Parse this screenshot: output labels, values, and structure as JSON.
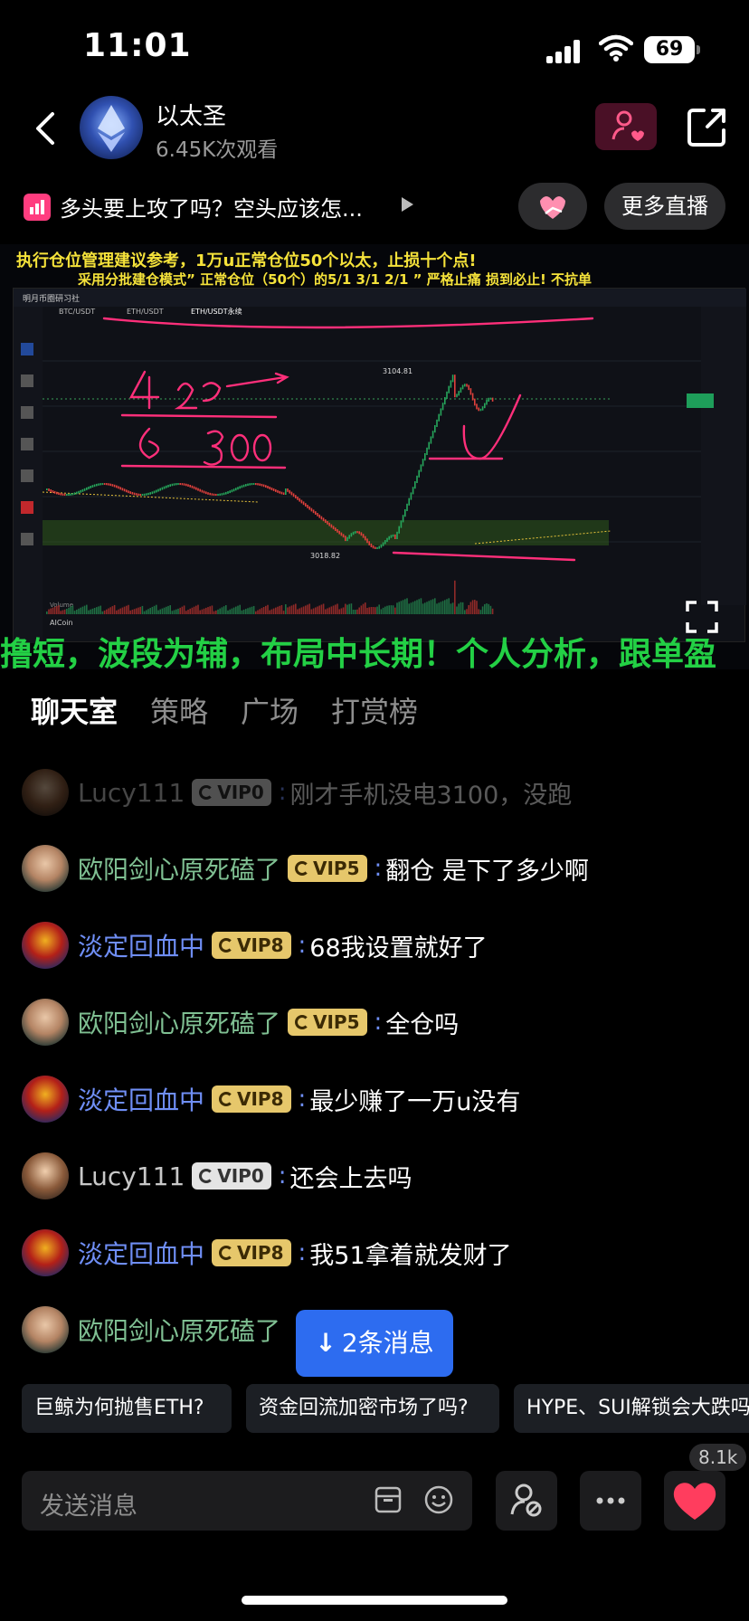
{
  "status_bar": {
    "time": "11:01",
    "battery": "69"
  },
  "header": {
    "title": "以太圣",
    "views": "6.45K次观看",
    "more_live": "更多直播"
  },
  "topic": {
    "text": "多头要上攻了吗？空头应该怎..."
  },
  "video": {
    "banner_line1": "执行仓位管理建议参考，1万u正常仓位50个以太，止损十个点!",
    "banner_line2": "采用分批建仓模式” 正常仓位（50个）的5/1  3/1  2/1 ” 严格止痛 损到必止! 不抗单",
    "scroll_text": "撸短，波段为辅，布局中长期！个人分析，跟单盈",
    "chart_labels": {
      "pair1": "BTC/USDT",
      "pair2": "ETH/USDT",
      "pair3": "ETH/USDT永续",
      "brand": "明月币圈研习社",
      "high": "3104.81",
      "low": "3018.82",
      "source": "AICoin",
      "volume": "Volume"
    }
  },
  "tabs": [
    {
      "label": "聊天室",
      "active": true
    },
    {
      "label": "策略",
      "active": false
    },
    {
      "label": "广场",
      "active": false
    },
    {
      "label": "打赏榜",
      "active": false
    }
  ],
  "messages": [
    {
      "nick": "Lucy111",
      "vip": "VIP0",
      "text": "刚才手机没电3100，没跑",
      "color": "gray"
    },
    {
      "nick": "欧阳剑心原死磕了",
      "vip": "VIP5",
      "text": "翻仓  是下了多少啊",
      "color": "green"
    },
    {
      "nick": "淡定回血中",
      "vip": "VIP8",
      "text": "68我设置就好了",
      "color": "blue"
    },
    {
      "nick": "欧阳剑心原死磕了",
      "vip": "VIP5",
      "text": "全仓吗",
      "color": "green"
    },
    {
      "nick": "淡定回血中",
      "vip": "VIP8",
      "text": "最少赚了一万u没有",
      "color": "blue"
    },
    {
      "nick": "Lucy111",
      "vip": "VIP0",
      "text": "还会上去吗",
      "color": "gray"
    },
    {
      "nick": "淡定回血中",
      "vip": "VIP8",
      "text": "我51拿着就发财了",
      "color": "blue"
    },
    {
      "nick": "欧阳剑心原死磕了",
      "vip": "",
      "text": "",
      "color": "green"
    }
  ],
  "new_messages": {
    "arrow": "↓",
    "label": "2条消息"
  },
  "chips": [
    "巨鲸为何抛售ETH?",
    "资金回流加密市场了吗?",
    "HYPE、SUI解锁会大跌吗"
  ],
  "input": {
    "placeholder": "发送消息"
  },
  "like_count": "8.1k",
  "colors": {
    "accent_blue": "#2d6cf0",
    "vip_gold": "#e6c76b",
    "heart": "#ff3d5e"
  }
}
